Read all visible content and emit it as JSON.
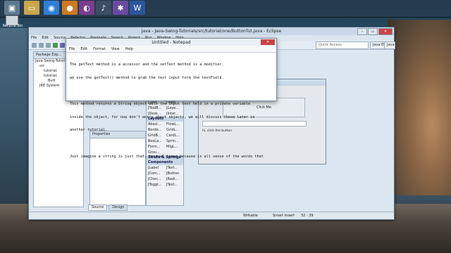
{
  "desktop": {
    "recycle_label": "Recycle Bin"
  },
  "eclipse": {
    "title": "Java - Java-Swing-Tutorials/src/tutorial/one/ButtonTut.java - Eclipse",
    "menu": [
      "File",
      "Edit",
      "Source",
      "Refactor",
      "Navigate",
      "Search",
      "Project",
      "Run",
      "Window",
      "Help"
    ],
    "quick_access": "Quick Access",
    "perspectives": [
      "Java EE",
      "Java"
    ],
    "package_explorer": {
      "tab": "Package Exp...",
      "items": [
        "Java-Swing-Tutorials",
        "src",
        "tutorial.",
        "tutorial.",
        "Butt",
        "JRE System"
      ]
    },
    "palette": {
      "rows1": [
        [
          "JSplit...",
          "JTabb..."
        ],
        [
          "JToolB...",
          "JLaye..."
        ],
        [
          "JDesk...",
          "JInter..."
        ]
      ],
      "cat_layouts": "Layouts",
      "rows2": [
        [
          "Absol...",
          "FlowL..."
        ],
        [
          "Borde...",
          "GridL..."
        ],
        [
          "GridB...",
          "CardL..."
        ],
        [
          "BoxLa...",
          "Sprin..."
        ],
        [
          "Form...",
          "MigL..."
        ],
        [
          "Grou...",
          ""
        ]
      ],
      "cat_struts": "Struts & Springs",
      "cat_components": "Components",
      "rows3": [
        [
          "JLabel",
          "JText..."
        ],
        [
          "JCom...",
          "JButton"
        ],
        [
          "JChec...",
          "JRadi..."
        ],
        [
          "JToggl...",
          "JText..."
        ]
      ]
    },
    "properties_tab": "Properties",
    "design": {
      "button_label": "Click Me",
      "label_text": "hi, click the button"
    },
    "source_tab": "Source",
    "design_tab": "Design",
    "status": {
      "writable": "Writable",
      "insert": "Smart Insert",
      "position": "32 : 39"
    }
  },
  "notepad": {
    "title": "Untitled - Notepad",
    "menu": [
      "File",
      "Edit",
      "Format",
      "View",
      "Help"
    ],
    "lines": [
      "The getText method is a accessor and the setText method is a modifier.",
      "we use the getText() method to grab the text input form the textField.",
      "",
      "This method returns a String object with the input text held in a private variable",
      "inside the object, for now don't worry about objects, we will discuss those later in",
      "another tutorial.",
      "",
      "Just imagine a string is just that, textual input because is all sense of the words that"
    ]
  }
}
